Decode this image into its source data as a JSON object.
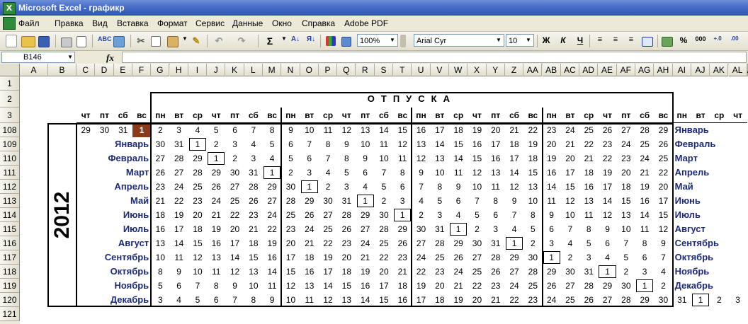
{
  "window": {
    "title": "Microsoft Excel - графикр"
  },
  "menu": [
    "Файл",
    "Правка",
    "Вид",
    "Вставка",
    "Формат",
    "Сервис",
    "Данные",
    "Окно",
    "Справка",
    "Adobe PDF"
  ],
  "toolbar": {
    "zoom": "100%",
    "font_name": "Arial Cyr",
    "font_size": "10",
    "bold": "Ж",
    "italic": "К",
    "underline": "Ч",
    "sum": "Σ",
    "percent": "%",
    "thousands": "000"
  },
  "formula_bar": {
    "name_box": "B146",
    "fx_label": "fx",
    "formula": ""
  },
  "columns": [
    "A",
    "B",
    "C",
    "D",
    "E",
    "F",
    "G",
    "H",
    "I",
    "J",
    "K",
    "L",
    "M",
    "N",
    "O",
    "P",
    "Q",
    "R",
    "S",
    "T",
    "U",
    "V",
    "W",
    "X",
    "Y",
    "Z",
    "AA",
    "AB",
    "AC",
    "AD",
    "AE",
    "AF",
    "AG",
    "AH",
    "AI",
    "AJ",
    "AK",
    "AL",
    "AM"
  ],
  "row_labels": [
    "1",
    "2",
    "3",
    "108",
    "109",
    "110",
    "111",
    "112",
    "113",
    "114",
    "115",
    "116",
    "117",
    "118",
    "119",
    "120",
    "121"
  ],
  "sheet": {
    "vacation_title": "ОТПУСКА",
    "year": "2012",
    "weekday_header": [
      "чт",
      "пт",
      "сб",
      "вс",
      "пн",
      "вт",
      "ср",
      "чт",
      "пт",
      "сб",
      "вс",
      "пн",
      "вт",
      "ср",
      "чт",
      "пт",
      "сб",
      "вс",
      "пн",
      "вт",
      "ср",
      "чт",
      "пт",
      "сб",
      "вс",
      "пн",
      "вт",
      "ср",
      "чт",
      "пт",
      "сб",
      "вс",
      "пн",
      "вт",
      "ср",
      "чт"
    ],
    "rows": [
      {
        "left_month": "",
        "right_month": "Январь",
        "days": [
          "29",
          "30",
          "31",
          "1",
          "2",
          "3",
          "4",
          "5",
          "6",
          "7",
          "8",
          "9",
          "10",
          "11",
          "12",
          "13",
          "14",
          "15",
          "16",
          "17",
          "18",
          "19",
          "20",
          "21",
          "22",
          "23",
          "24",
          "25",
          "26",
          "27",
          "28",
          "29"
        ],
        "today": 3,
        "boxed": -1
      },
      {
        "left_month": "Январь",
        "right_month": "Февраль",
        "days": [
          "",
          "",
          "",
          "",
          "30",
          "31",
          "1",
          "2",
          "3",
          "4",
          "5",
          "6",
          "7",
          "8",
          "9",
          "10",
          "11",
          "12",
          "13",
          "14",
          "15",
          "16",
          "17",
          "18",
          "19",
          "20",
          "21",
          "22",
          "23",
          "24",
          "25",
          "26"
        ],
        "today": -1,
        "boxed": 6
      },
      {
        "left_month": "Февраль",
        "right_month": "Март",
        "days": [
          "",
          "",
          "",
          "",
          "27",
          "28",
          "29",
          "1",
          "2",
          "3",
          "4",
          "5",
          "6",
          "7",
          "8",
          "9",
          "10",
          "11",
          "12",
          "13",
          "14",
          "15",
          "16",
          "17",
          "18",
          "19",
          "20",
          "21",
          "22",
          "23",
          "24",
          "25"
        ],
        "today": -1,
        "boxed": 7
      },
      {
        "left_month": "Март",
        "right_month": "Апрель",
        "days": [
          "",
          "",
          "",
          "",
          "26",
          "27",
          "28",
          "29",
          "30",
          "31",
          "1",
          "2",
          "3",
          "4",
          "5",
          "6",
          "7",
          "8",
          "9",
          "10",
          "11",
          "12",
          "13",
          "14",
          "15",
          "16",
          "17",
          "18",
          "19",
          "20",
          "21",
          "22"
        ],
        "today": -1,
        "boxed": 10
      },
      {
        "left_month": "Апрель",
        "right_month": "Май",
        "days": [
          "",
          "",
          "",
          "",
          "23",
          "24",
          "25",
          "26",
          "27",
          "28",
          "29",
          "30",
          "1",
          "2",
          "3",
          "4",
          "5",
          "6",
          "7",
          "8",
          "9",
          "10",
          "11",
          "12",
          "13",
          "14",
          "15",
          "16",
          "17",
          "18",
          "19",
          "20"
        ],
        "today": -1,
        "boxed": 12
      },
      {
        "left_month": "Май",
        "right_month": "Июнь",
        "days": [
          "",
          "",
          "",
          "",
          "21",
          "22",
          "23",
          "24",
          "25",
          "26",
          "27",
          "28",
          "29",
          "30",
          "31",
          "1",
          "2",
          "3",
          "4",
          "5",
          "6",
          "7",
          "8",
          "9",
          "10",
          "11",
          "12",
          "13",
          "14",
          "15",
          "16",
          "17"
        ],
        "today": -1,
        "boxed": 15
      },
      {
        "left_month": "Июнь",
        "right_month": "Июль",
        "days": [
          "",
          "",
          "",
          "",
          "18",
          "19",
          "20",
          "21",
          "22",
          "23",
          "24",
          "25",
          "26",
          "27",
          "28",
          "29",
          "30",
          "1",
          "2",
          "3",
          "4",
          "5",
          "6",
          "7",
          "8",
          "9",
          "10",
          "11",
          "12",
          "13",
          "14",
          "15"
        ],
        "today": -1,
        "boxed": 17
      },
      {
        "left_month": "Июль",
        "right_month": "Август",
        "days": [
          "",
          "",
          "",
          "",
          "16",
          "17",
          "18",
          "19",
          "20",
          "21",
          "22",
          "23",
          "24",
          "25",
          "26",
          "27",
          "28",
          "29",
          "30",
          "31",
          "1",
          "2",
          "3",
          "4",
          "5",
          "6",
          "7",
          "8",
          "9",
          "10",
          "11",
          "12"
        ],
        "today": -1,
        "boxed": 20
      },
      {
        "left_month": "Август",
        "right_month": "Сентябрь",
        "days": [
          "",
          "",
          "",
          "",
          "13",
          "14",
          "15",
          "16",
          "17",
          "18",
          "19",
          "20",
          "21",
          "22",
          "23",
          "24",
          "25",
          "26",
          "27",
          "28",
          "29",
          "30",
          "31",
          "1",
          "2",
          "3",
          "4",
          "5",
          "6",
          "7",
          "8",
          "9"
        ],
        "today": -1,
        "boxed": 23
      },
      {
        "left_month": "Сентябрь",
        "right_month": "Октябрь",
        "days": [
          "",
          "",
          "",
          "",
          "10",
          "11",
          "12",
          "13",
          "14",
          "15",
          "16",
          "17",
          "18",
          "19",
          "20",
          "21",
          "22",
          "23",
          "24",
          "25",
          "26",
          "27",
          "28",
          "29",
          "30",
          "1",
          "2",
          "3",
          "4",
          "5",
          "6",
          "7"
        ],
        "today": -1,
        "boxed": 25
      },
      {
        "left_month": "Октябрь",
        "right_month": "Ноябрь",
        "days": [
          "",
          "",
          "",
          "",
          "8",
          "9",
          "10",
          "11",
          "12",
          "13",
          "14",
          "15",
          "16",
          "17",
          "18",
          "19",
          "20",
          "21",
          "22",
          "23",
          "24",
          "25",
          "26",
          "27",
          "28",
          "29",
          "30",
          "31",
          "1",
          "2",
          "3",
          "4"
        ],
        "today": -1,
        "boxed": 28
      },
      {
        "left_month": "Ноябрь",
        "right_month": "Декабрь",
        "days": [
          "",
          "",
          "",
          "",
          "5",
          "6",
          "7",
          "8",
          "9",
          "10",
          "11",
          "12",
          "13",
          "14",
          "15",
          "16",
          "17",
          "18",
          "19",
          "20",
          "21",
          "22",
          "23",
          "24",
          "25",
          "26",
          "27",
          "28",
          "29",
          "30",
          "1",
          "2"
        ],
        "today": -1,
        "boxed": 30
      },
      {
        "left_month": "Декабрь",
        "right_month": "",
        "days": [
          "",
          "",
          "",
          "",
          "3",
          "4",
          "5",
          "6",
          "7",
          "8",
          "9",
          "10",
          "11",
          "12",
          "13",
          "14",
          "15",
          "16",
          "17",
          "18",
          "19",
          "20",
          "21",
          "22",
          "23",
          "24",
          "25",
          "26",
          "27",
          "28",
          "29",
          "30",
          "31",
          "1",
          "2",
          "3"
        ],
        "today": -1,
        "boxed": 33
      }
    ]
  }
}
